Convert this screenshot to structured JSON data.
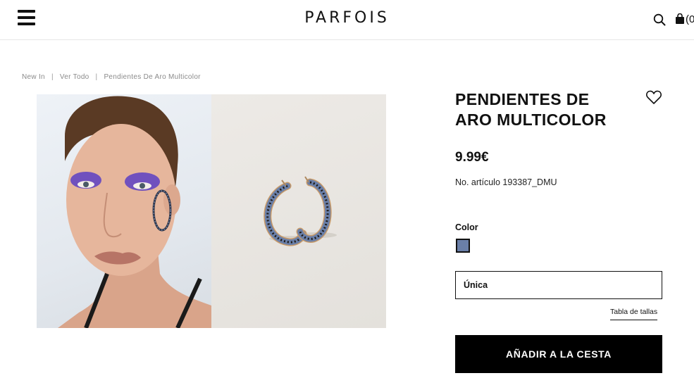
{
  "header": {
    "logo": "PARFOIS",
    "bag_count": "(0"
  },
  "breadcrumb": [
    "New In",
    "Ver Todo",
    "Pendientes De Aro Multicolor"
  ],
  "product": {
    "title_line1": "PENDIENTES DE",
    "title_line2": "ARO MULTICOLOR",
    "price": "9.99€",
    "sku": "No. artículo 193387_DMU",
    "color_label": "Color",
    "swatch_color": "#6a7fa8",
    "size_value": "Única",
    "size_guide": "Tabla de tallas",
    "add_to_cart": "AÑADIR A LA CESTA"
  },
  "icons": [
    "menu-icon",
    "search-icon",
    "shopping-bag-icon",
    "heart-icon"
  ],
  "colors": {
    "text": "#111111",
    "muted": "#8a8a8a",
    "button_bg": "#000000",
    "button_text": "#ffffff"
  }
}
